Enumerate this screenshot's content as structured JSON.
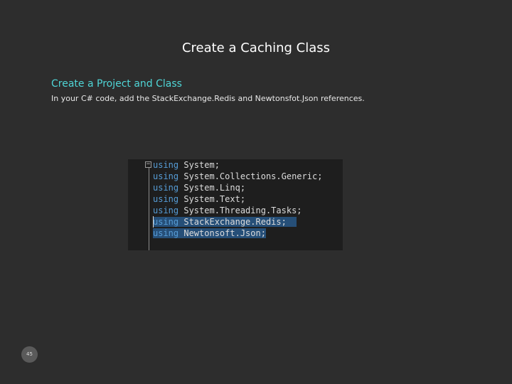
{
  "slide": {
    "title": "Create a Caching Class",
    "subtitle": "Create a Project and Class",
    "description": "In your C# code, add the StackExchange.Redis and Newtonsfot.Json references.",
    "page_number": "45"
  },
  "code": {
    "keyword": "using",
    "lines": [
      {
        "keyword": "using",
        "namespace": "System;"
      },
      {
        "keyword": "using",
        "namespace": "System.Collections.Generic;"
      },
      {
        "keyword": "using",
        "namespace": "System.Linq;"
      },
      {
        "keyword": "using",
        "namespace": "System.Text;"
      },
      {
        "keyword": "using",
        "namespace": "System.Threading.Tasks;"
      },
      {
        "keyword": "using",
        "namespace": "StackExchange.Redis;"
      },
      {
        "keyword": "using",
        "namespace": "Newtonsoft.Json;"
      }
    ],
    "collapse_glyph": "−"
  },
  "colors": {
    "background": "#2d2d2d",
    "subtitle": "#4fd5d6",
    "keyword": "#569cd6",
    "selection": "#264f78"
  }
}
